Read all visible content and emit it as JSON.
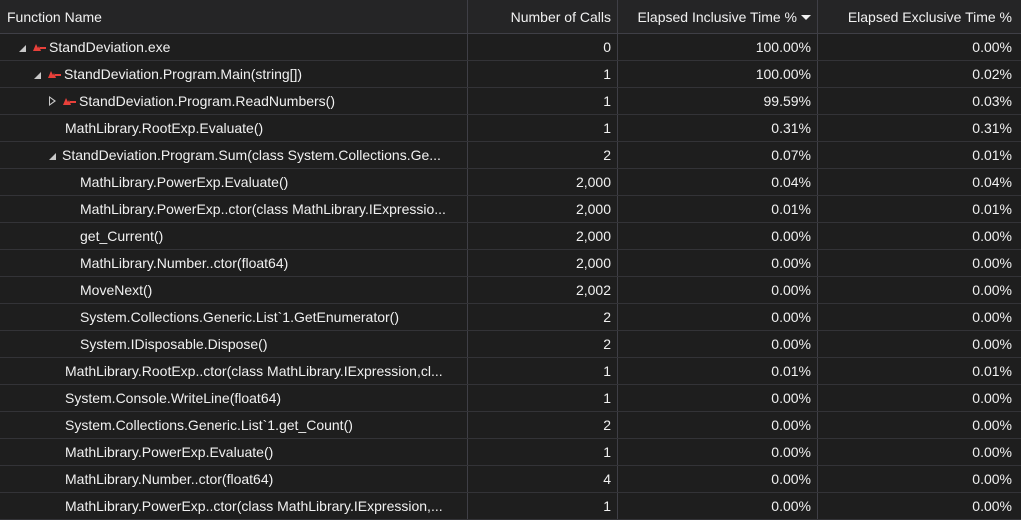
{
  "colors": {
    "background": "#1e1e1e",
    "header_background": "#252526",
    "text": "#f1f1f1",
    "grid_line": "#3f3f46",
    "hot_path_icon": "#e8403a"
  },
  "columns": {
    "function_name": "Function Name",
    "number_of_calls": "Number of Calls",
    "elapsed_inclusive": "Elapsed Inclusive Time %",
    "elapsed_exclusive": "Elapsed Exclusive Time %"
  },
  "sort": {
    "column": "elapsed_inclusive",
    "direction": "descending",
    "icon": "sort-descending-icon"
  },
  "rows": [
    {
      "level": 0,
      "toggle": "expanded",
      "hot": true,
      "name": "StandDeviation.exe",
      "calls": "0",
      "inclusive": "100.00%",
      "exclusive": "0.00%"
    },
    {
      "level": 1,
      "toggle": "expanded",
      "hot": true,
      "name": "StandDeviation.Program.Main(string[])",
      "calls": "1",
      "inclusive": "100.00%",
      "exclusive": "0.02%"
    },
    {
      "level": 2,
      "toggle": "collapsed",
      "hot": true,
      "name": "StandDeviation.Program.ReadNumbers()",
      "calls": "1",
      "inclusive": "99.59%",
      "exclusive": "0.03%"
    },
    {
      "level": 2,
      "toggle": "none",
      "hot": false,
      "name": "MathLibrary.RootExp.Evaluate()",
      "calls": "1",
      "inclusive": "0.31%",
      "exclusive": "0.31%"
    },
    {
      "level": 2,
      "toggle": "expanded",
      "hot": false,
      "name": "StandDeviation.Program.Sum(class System.Collections.Ge...",
      "calls": "2",
      "inclusive": "0.07%",
      "exclusive": "0.01%"
    },
    {
      "level": 3,
      "toggle": "none",
      "hot": false,
      "name": "MathLibrary.PowerExp.Evaluate()",
      "calls": "2,000",
      "inclusive": "0.04%",
      "exclusive": "0.04%"
    },
    {
      "level": 3,
      "toggle": "none",
      "hot": false,
      "name": "MathLibrary.PowerExp..ctor(class MathLibrary.IExpressio...",
      "calls": "2,000",
      "inclusive": "0.01%",
      "exclusive": "0.01%"
    },
    {
      "level": 3,
      "toggle": "none",
      "hot": false,
      "name": "get_Current()",
      "calls": "2,000",
      "inclusive": "0.00%",
      "exclusive": "0.00%"
    },
    {
      "level": 3,
      "toggle": "none",
      "hot": false,
      "name": "MathLibrary.Number..ctor(float64)",
      "calls": "2,000",
      "inclusive": "0.00%",
      "exclusive": "0.00%"
    },
    {
      "level": 3,
      "toggle": "none",
      "hot": false,
      "name": "MoveNext()",
      "calls": "2,002",
      "inclusive": "0.00%",
      "exclusive": "0.00%"
    },
    {
      "level": 3,
      "toggle": "none",
      "hot": false,
      "name": "System.Collections.Generic.List`1.GetEnumerator()",
      "calls": "2",
      "inclusive": "0.00%",
      "exclusive": "0.00%"
    },
    {
      "level": 3,
      "toggle": "none",
      "hot": false,
      "name": "System.IDisposable.Dispose()",
      "calls": "2",
      "inclusive": "0.00%",
      "exclusive": "0.00%"
    },
    {
      "level": 2,
      "toggle": "none",
      "hot": false,
      "name": "MathLibrary.RootExp..ctor(class MathLibrary.IExpression,cl...",
      "calls": "1",
      "inclusive": "0.01%",
      "exclusive": "0.01%"
    },
    {
      "level": 2,
      "toggle": "none",
      "hot": false,
      "name": "System.Console.WriteLine(float64)",
      "calls": "1",
      "inclusive": "0.00%",
      "exclusive": "0.00%"
    },
    {
      "level": 2,
      "toggle": "none",
      "hot": false,
      "name": "System.Collections.Generic.List`1.get_Count()",
      "calls": "2",
      "inclusive": "0.00%",
      "exclusive": "0.00%"
    },
    {
      "level": 2,
      "toggle": "none",
      "hot": false,
      "name": "MathLibrary.PowerExp.Evaluate()",
      "calls": "1",
      "inclusive": "0.00%",
      "exclusive": "0.00%"
    },
    {
      "level": 2,
      "toggle": "none",
      "hot": false,
      "name": "MathLibrary.Number..ctor(float64)",
      "calls": "4",
      "inclusive": "0.00%",
      "exclusive": "0.00%"
    },
    {
      "level": 2,
      "toggle": "none",
      "hot": false,
      "name": "MathLibrary.PowerExp..ctor(class MathLibrary.IExpression,...",
      "calls": "1",
      "inclusive": "0.00%",
      "exclusive": "0.00%"
    }
  ]
}
